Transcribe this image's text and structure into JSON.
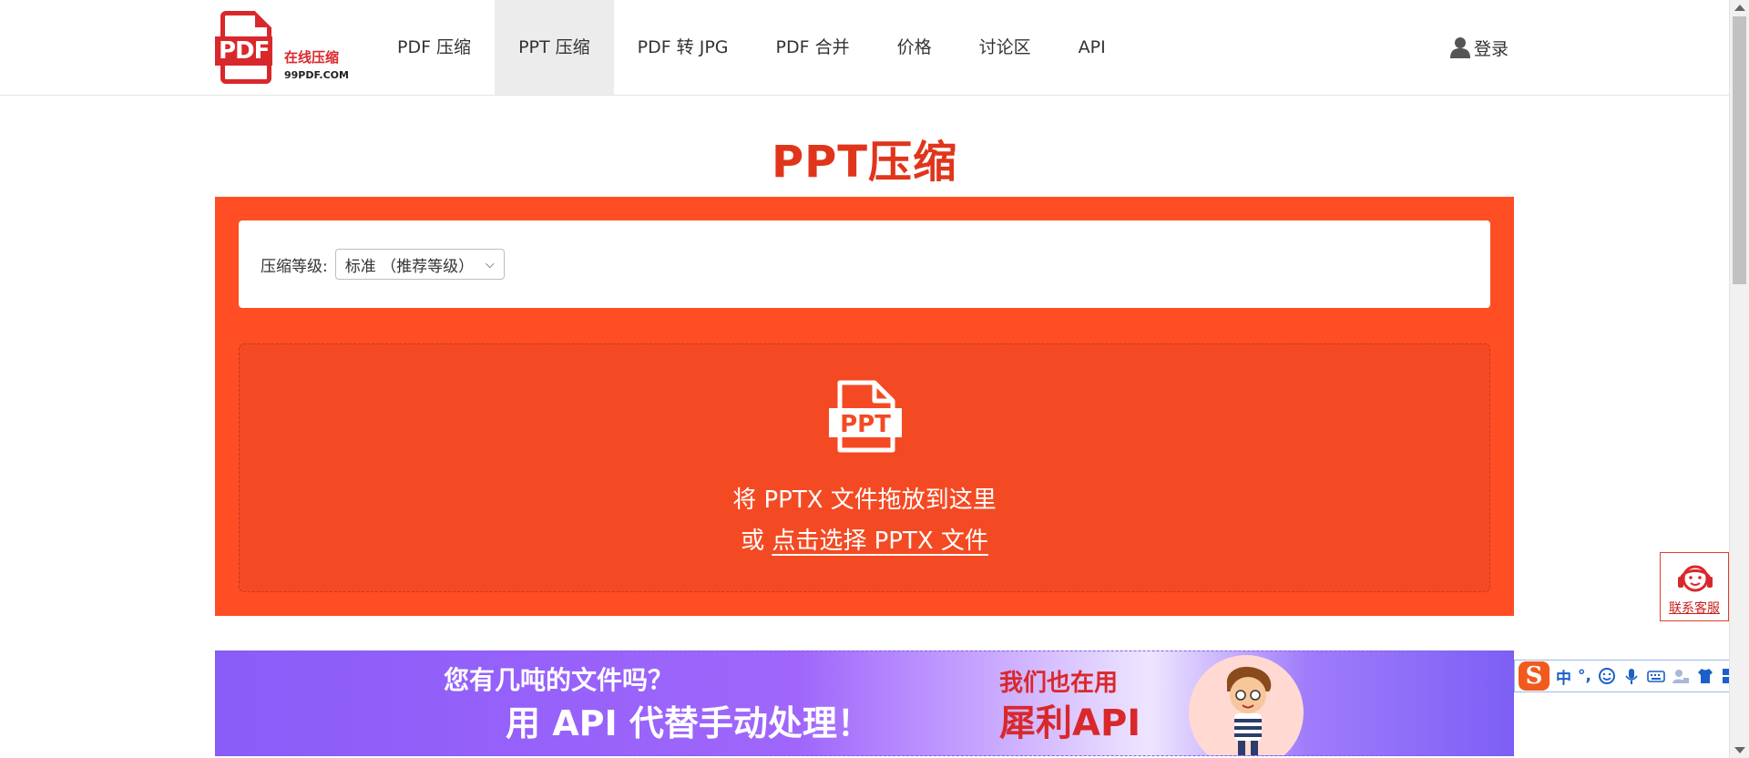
{
  "header": {
    "logo": {
      "pdf": "PDF",
      "tagline": "在线压缩",
      "site": "99PDF.COM"
    },
    "nav": [
      {
        "label": "PDF 压缩",
        "active": false
      },
      {
        "label": "PPT 压缩",
        "active": true
      },
      {
        "label": "PDF 转 JPG",
        "active": false
      },
      {
        "label": "PDF 合并",
        "active": false
      },
      {
        "label": "价格",
        "active": false
      },
      {
        "label": "讨论区",
        "active": false
      },
      {
        "label": "API",
        "active": false
      }
    ],
    "login_label": "登录"
  },
  "main": {
    "title": "PPT压缩",
    "options": {
      "level_label": "压缩等级:",
      "level_value": "标准 （推荐等级）"
    },
    "dropzone": {
      "icon_text": "PPT",
      "line1": "将 PPTX 文件拖放到这里",
      "line2_prefix": "或 ",
      "line2_link": "点击选择 PPTX 文件"
    }
  },
  "banner": {
    "line1": "您有几吨的文件吗？",
    "line2": "用 API 代替手动处理！",
    "right1": "我们也在用",
    "right2": "犀利API"
  },
  "service": {
    "label": "联系客服"
  },
  "ime": {
    "lang": "中",
    "punct": "°,"
  },
  "colors": {
    "brand": "#ff4d24",
    "title": "#e0351b",
    "logo": "#d9282c"
  }
}
